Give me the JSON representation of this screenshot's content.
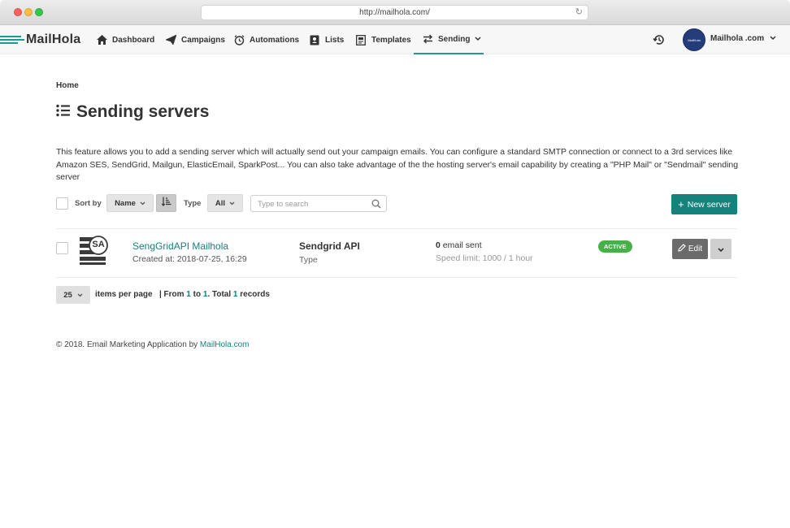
{
  "browser": {
    "url": "http://mailhola.com/"
  },
  "nav": {
    "brand": "MailHola",
    "items": [
      {
        "label": "Dashboard",
        "icon": "home-icon"
      },
      {
        "label": "Campaigns",
        "icon": "paper-plane-icon"
      },
      {
        "label": "Automations",
        "icon": "alarm-clock-icon"
      },
      {
        "label": "Lists",
        "icon": "address-book-icon"
      },
      {
        "label": "Templates",
        "icon": "template-icon"
      },
      {
        "label": "Sending",
        "icon": "exchange-icon",
        "active": true
      }
    ],
    "account_name": "Mailhola .com",
    "avatar_text": "MailHola"
  },
  "breadcrumb": "Home",
  "page_title": "Sending servers",
  "description": "This feature allows you to add a sending server which will actually send out your campaign emails. You can configure a standard SMTP connection or connect to a 3rd services like Amazon SES, SendGrid, Mailgun, ElasticEmail, SparkPost... You can also take advantage of the the hosting server's email capability by creating a \"PHP Mail\" or \"Sendmail\" sending server",
  "toolbar": {
    "sort_by_label": "Sort by",
    "sort_value": "Name",
    "type_label": "Type",
    "type_value": "All",
    "search_placeholder": "Type to search",
    "new_button": "New server"
  },
  "servers": [
    {
      "initials": "SA",
      "name": "SengGridAPI Mailhola",
      "created": "Created at: 2018-07-25, 16:29",
      "type": "Sendgrid API",
      "type_label": "Type",
      "sent_count": "0",
      "sent_label": "email sent",
      "speed": "Speed limit: 1000 / 1 hour",
      "status": "ACTIVE",
      "edit_label": "Edit"
    }
  ],
  "pager": {
    "per_page": "25",
    "per_page_label": "items per page",
    "from_prefix": "| From",
    "from": "1",
    "to_word": "to",
    "to": "1",
    "total_word": ". Total",
    "total": "1",
    "records_word": "records"
  },
  "footer": {
    "text": "© 2018. Email Marketing Application by",
    "link": "MailHola.com"
  },
  "colors": {
    "accent": "#16827c",
    "active_badge": "#47b049"
  }
}
